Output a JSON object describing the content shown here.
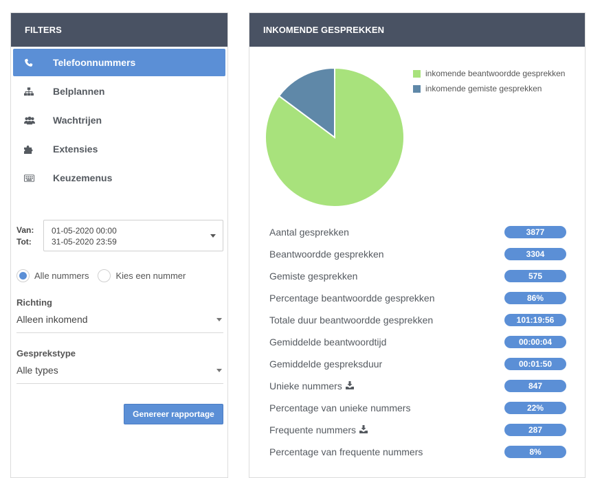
{
  "filters": {
    "title": "FILTERS",
    "nav": [
      {
        "label": "Telefoonnummers",
        "icon": "phone-icon",
        "active": true
      },
      {
        "label": "Belplannen",
        "icon": "sitemap-icon",
        "active": false
      },
      {
        "label": "Wachtrijen",
        "icon": "users-icon",
        "active": false
      },
      {
        "label": "Extensies",
        "icon": "puzzle-icon",
        "active": false
      },
      {
        "label": "Keuzemenus",
        "icon": "keyboard-icon",
        "active": false
      }
    ],
    "date": {
      "from_label": "Van:",
      "to_label": "Tot:",
      "from_value": "01-05-2020 00:00",
      "to_value": "31-05-2020 23:59"
    },
    "radios": [
      {
        "label": "Alle nummers",
        "checked": true
      },
      {
        "label": "Kies een nummer",
        "checked": false
      }
    ],
    "direction": {
      "label": "Richting",
      "value": "Alleen inkomend"
    },
    "call_type": {
      "label": "Gesprekstype",
      "value": "Alle types"
    },
    "generate_label": "Genereer rapportage"
  },
  "report": {
    "title": "INKOMENDE GESPREKKEN",
    "chart_data": {
      "type": "pie",
      "slices": [
        {
          "label": "inkomende beantwoordde gesprekken",
          "value": 3304,
          "color": "#a8e27c"
        },
        {
          "label": "inkomende gemiste gesprekken",
          "value": 575,
          "color": "#5f88a8"
        }
      ]
    },
    "stats": [
      {
        "label": "Aantal gesprekken",
        "value": "3877",
        "download": false
      },
      {
        "label": "Beantwoordde gesprekken",
        "value": "3304",
        "download": false
      },
      {
        "label": "Gemiste gesprekken",
        "value": "575",
        "download": false
      },
      {
        "label": "Percentage beantwoordde gesprekken",
        "value": "86%",
        "download": false
      },
      {
        "label": "Totale duur beantwoordde gesprekken",
        "value": "101:19:56",
        "download": false
      },
      {
        "label": "Gemiddelde beantwoordtijd",
        "value": "00:00:04",
        "download": false
      },
      {
        "label": "Gemiddelde gespreksduur",
        "value": "00:01:50",
        "download": false
      },
      {
        "label": "Unieke nummers",
        "value": "847",
        "download": true
      },
      {
        "label": "Percentage van unieke nummers",
        "value": "22%",
        "download": false
      },
      {
        "label": "Frequente nummers",
        "value": "287",
        "download": true
      },
      {
        "label": "Percentage van frequente nummers",
        "value": "8%",
        "download": false
      }
    ]
  }
}
